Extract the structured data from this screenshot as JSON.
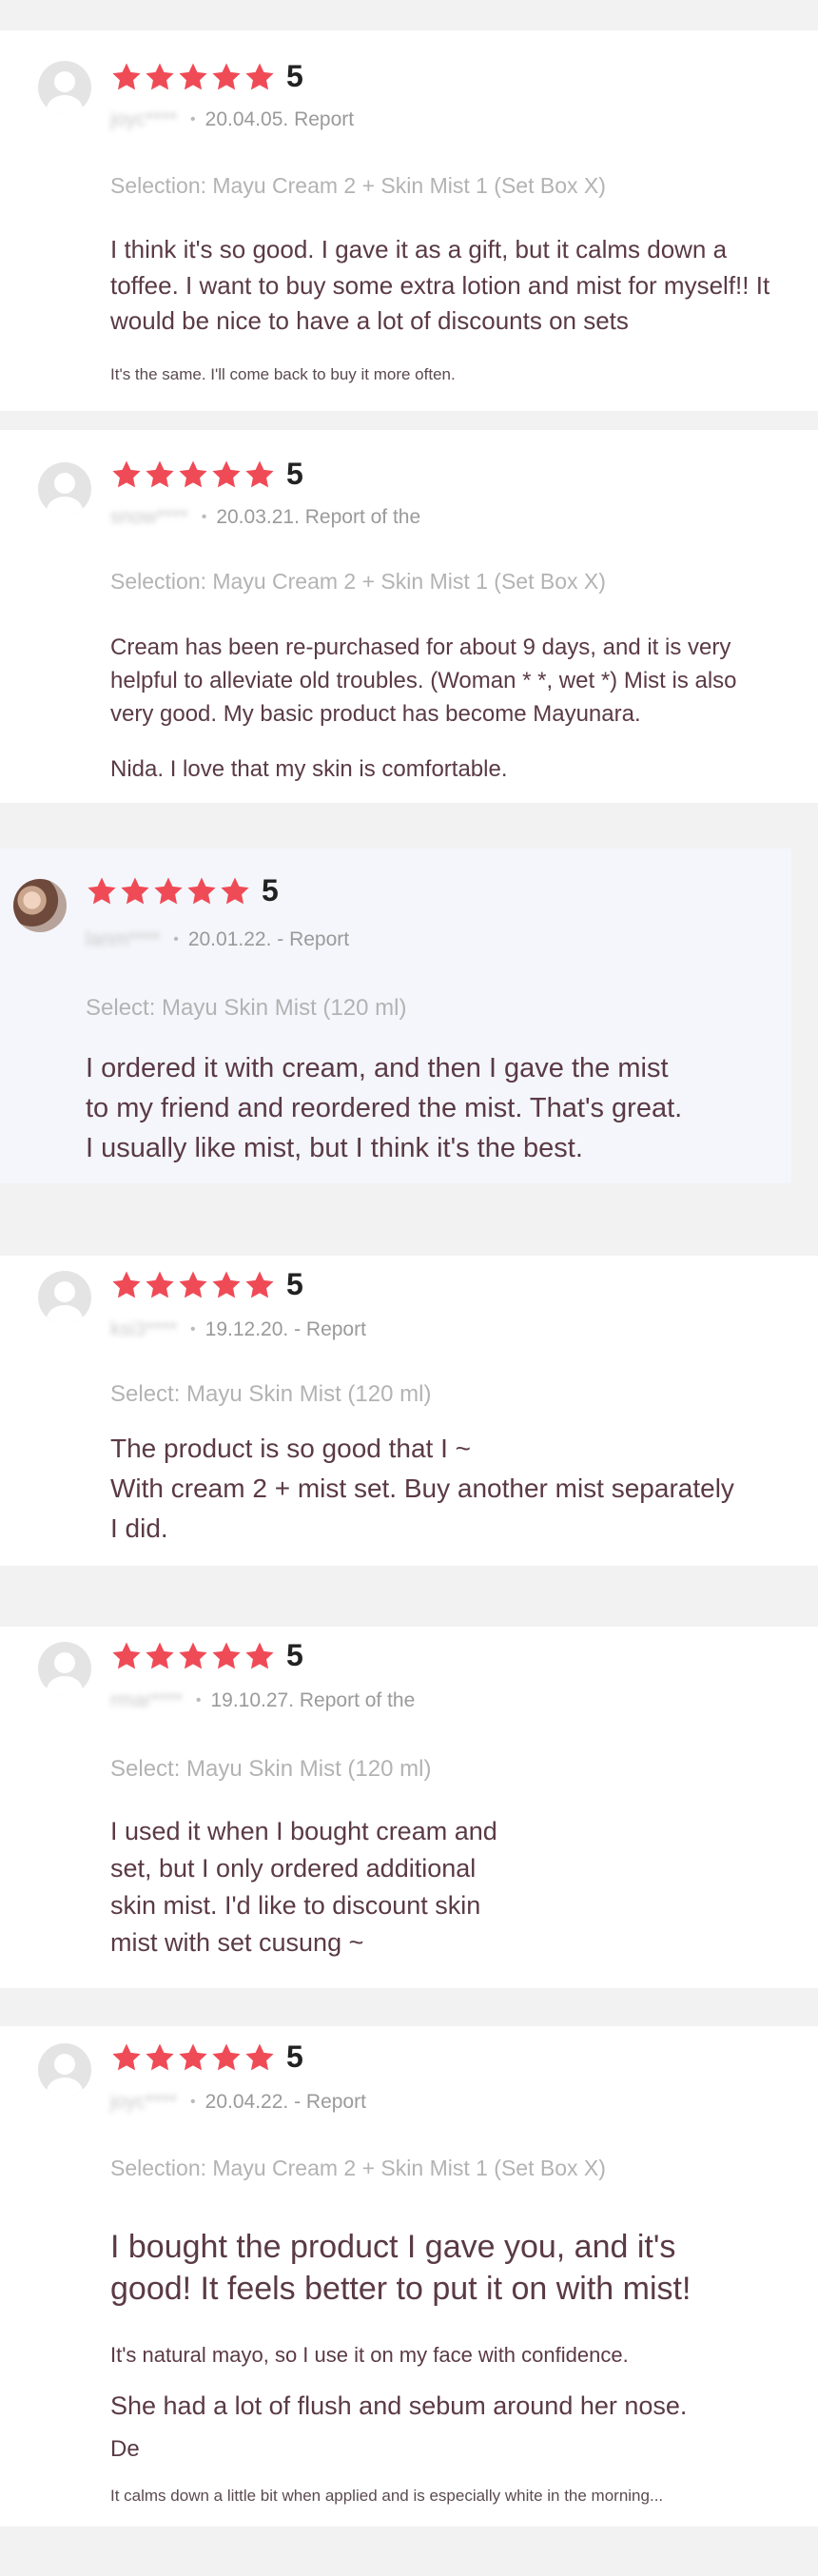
{
  "rating_max": 5,
  "colors": {
    "star": "#ef4b57",
    "review_text": "#5a3a45",
    "meta": "#9a9a9a"
  },
  "reviews": [
    {
      "score": "5",
      "user": "joyc****",
      "meta": "20.04.05. Report",
      "selection": "Selection: Mayu Cream 2 + Skin Mist 1 (Set Box X)",
      "body": "I think it's so good. I gave it as a gift, but it calms down a toffee. I want to buy some extra lotion and mist for myself!! It would be nice to have a lot of discounts on sets",
      "extra": "It's the same. I'll come back to buy it more often."
    },
    {
      "score": "5",
      "user": "snow****",
      "meta": "20.03.21. Report of the",
      "selection": "Selection: Mayu Cream 2 + Skin Mist 1 (Set Box X)",
      "body": "Cream has been re-purchased for about 9 days, and it is very helpful to alleviate old troubles. (Woman * *, wet *) Mist is also very good. My basic product has become Mayunara.",
      "extra": "Nida. I love that my skin is comfortable."
    },
    {
      "score": "5",
      "user": "lanm****",
      "meta": "20.01.22. - Report",
      "selection": "Select: Mayu Skin Mist (120 ml)",
      "body_lines": [
        "I ordered it with cream, and then I gave the mist",
        "to my friend and reordered the mist. That's great.",
        "I usually like mist, but I think it's the best."
      ]
    },
    {
      "score": "5",
      "user": "ksi3****",
      "meta": "19.12.20. - Report",
      "selection": "Select: Mayu Skin Mist (120 ml)",
      "body_lines": [
        "The product is so good that I ~",
        "With cream 2 + mist set. Buy another mist separately",
        "I did."
      ]
    },
    {
      "score": "5",
      "user": "rmar****",
      "meta": "19.10.27. Report of the",
      "selection": "Select: Mayu Skin Mist (120 ml)",
      "body_lines": [
        "I used it when I bought cream and",
        "set, but I only ordered additional",
        "skin mist. I'd like to discount skin",
        "mist with set cusung ~"
      ]
    },
    {
      "score": "5",
      "user": "joyc****",
      "meta": "20.04.22. - Report",
      "selection": "Selection: Mayu Cream 2 + Skin Mist 1 (Set Box X)",
      "body_lines": [
        "I bought the product I gave you, and it's",
        "good! It feels better to put it on with mist!"
      ],
      "line2": "It's natural mayo, so I use it on my face with confidence.",
      "line3": "She had a lot of flush and sebum around her nose.",
      "line4": "De",
      "line5": "It calms down a little bit when applied and is especially white in the morning..."
    }
  ]
}
